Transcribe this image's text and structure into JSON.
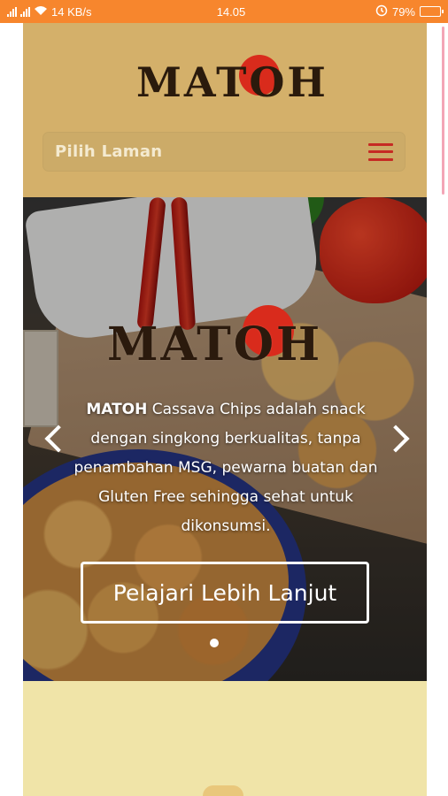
{
  "status_bar": {
    "left": "14 KB/s",
    "time": "14.05",
    "battery": "79%",
    "battery_level": 0.79,
    "icons": [
      "signal-icon",
      "signal-icon",
      "wifi-icon",
      "alarm-icon",
      "battery-icon"
    ]
  },
  "header": {
    "logo_text": "MATOH",
    "nav_label": "Pilih Laman",
    "colors": {
      "background": "#d4b06a",
      "accent": "#c62a24"
    }
  },
  "hero": {
    "logo_text": "MATOH",
    "brand": "MATOH",
    "description": " Cassava Chips adalah snack dengan singkong berkualitas, tanpa penambahan MSG, pewarna buatan dan Gluten Free sehingga sehat untuk dikonsumsi.",
    "cta_label": "Pelajari Lebih Lanjut",
    "slides_total": 1,
    "slide_active": 1
  }
}
